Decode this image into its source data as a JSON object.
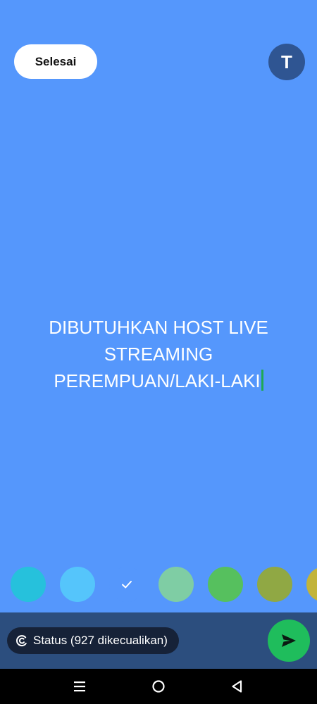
{
  "toolbar": {
    "done_label": "Selesai",
    "text_tool_label": "T"
  },
  "status_text": {
    "lines": [
      "DIBUTUHKAN HOST LIVE",
      "STREAMING",
      "PEREMPUAN/LAKI-LAKI"
    ]
  },
  "colors": {
    "background": "#5597fc",
    "caret": "#1fa855",
    "send": "#1fbd5c"
  },
  "swatches": [
    {
      "color": "#26c1dc",
      "selected": false
    },
    {
      "color": "#55c5fb",
      "selected": false
    },
    {
      "color": "#5597fc",
      "selected": true
    },
    {
      "color": "#7fcda4",
      "selected": false
    },
    {
      "color": "#56c05e",
      "selected": false
    },
    {
      "color": "#90a844",
      "selected": false
    },
    {
      "color": "#c2b43a",
      "selected": false
    }
  ],
  "bottom_bar": {
    "audience_label": "Status (927 dikecualikan)",
    "audience_icon": "privacy-icon",
    "send_icon": "send-icon"
  },
  "nav": {
    "icons": [
      "recents-icon",
      "home-icon",
      "back-icon"
    ]
  }
}
